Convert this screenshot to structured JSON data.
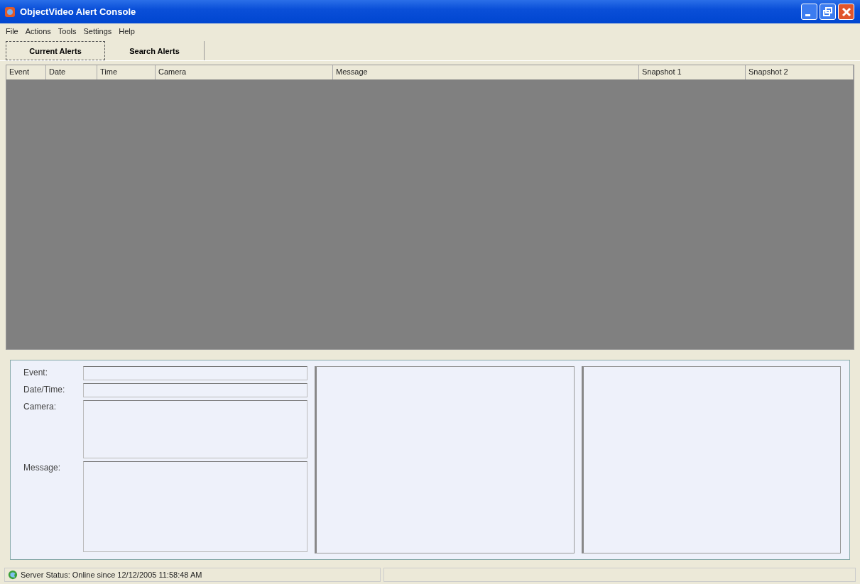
{
  "window": {
    "title": "ObjectVideo Alert Console"
  },
  "menu": [
    "File",
    "Actions",
    "Tools",
    "Settings",
    "Help"
  ],
  "tabs": [
    {
      "label": "Current Alerts",
      "selected": true
    },
    {
      "label": "Search Alerts",
      "selected": false
    }
  ],
  "table": {
    "columns": [
      "Event",
      "Date",
      "Time",
      "Camera",
      "Message",
      "Snapshot 1",
      "Snapshot 2"
    ]
  },
  "details": [
    {
      "label": "Event:",
      "kind": "line"
    },
    {
      "label": "Date/Time:",
      "kind": "line"
    },
    {
      "label": "Camera:",
      "kind": "area"
    },
    {
      "label": "Message:",
      "kind": "tall"
    }
  ],
  "status_bar": {
    "text": "Server Status: Online since 12/12/2005 11:58:48 AM"
  }
}
